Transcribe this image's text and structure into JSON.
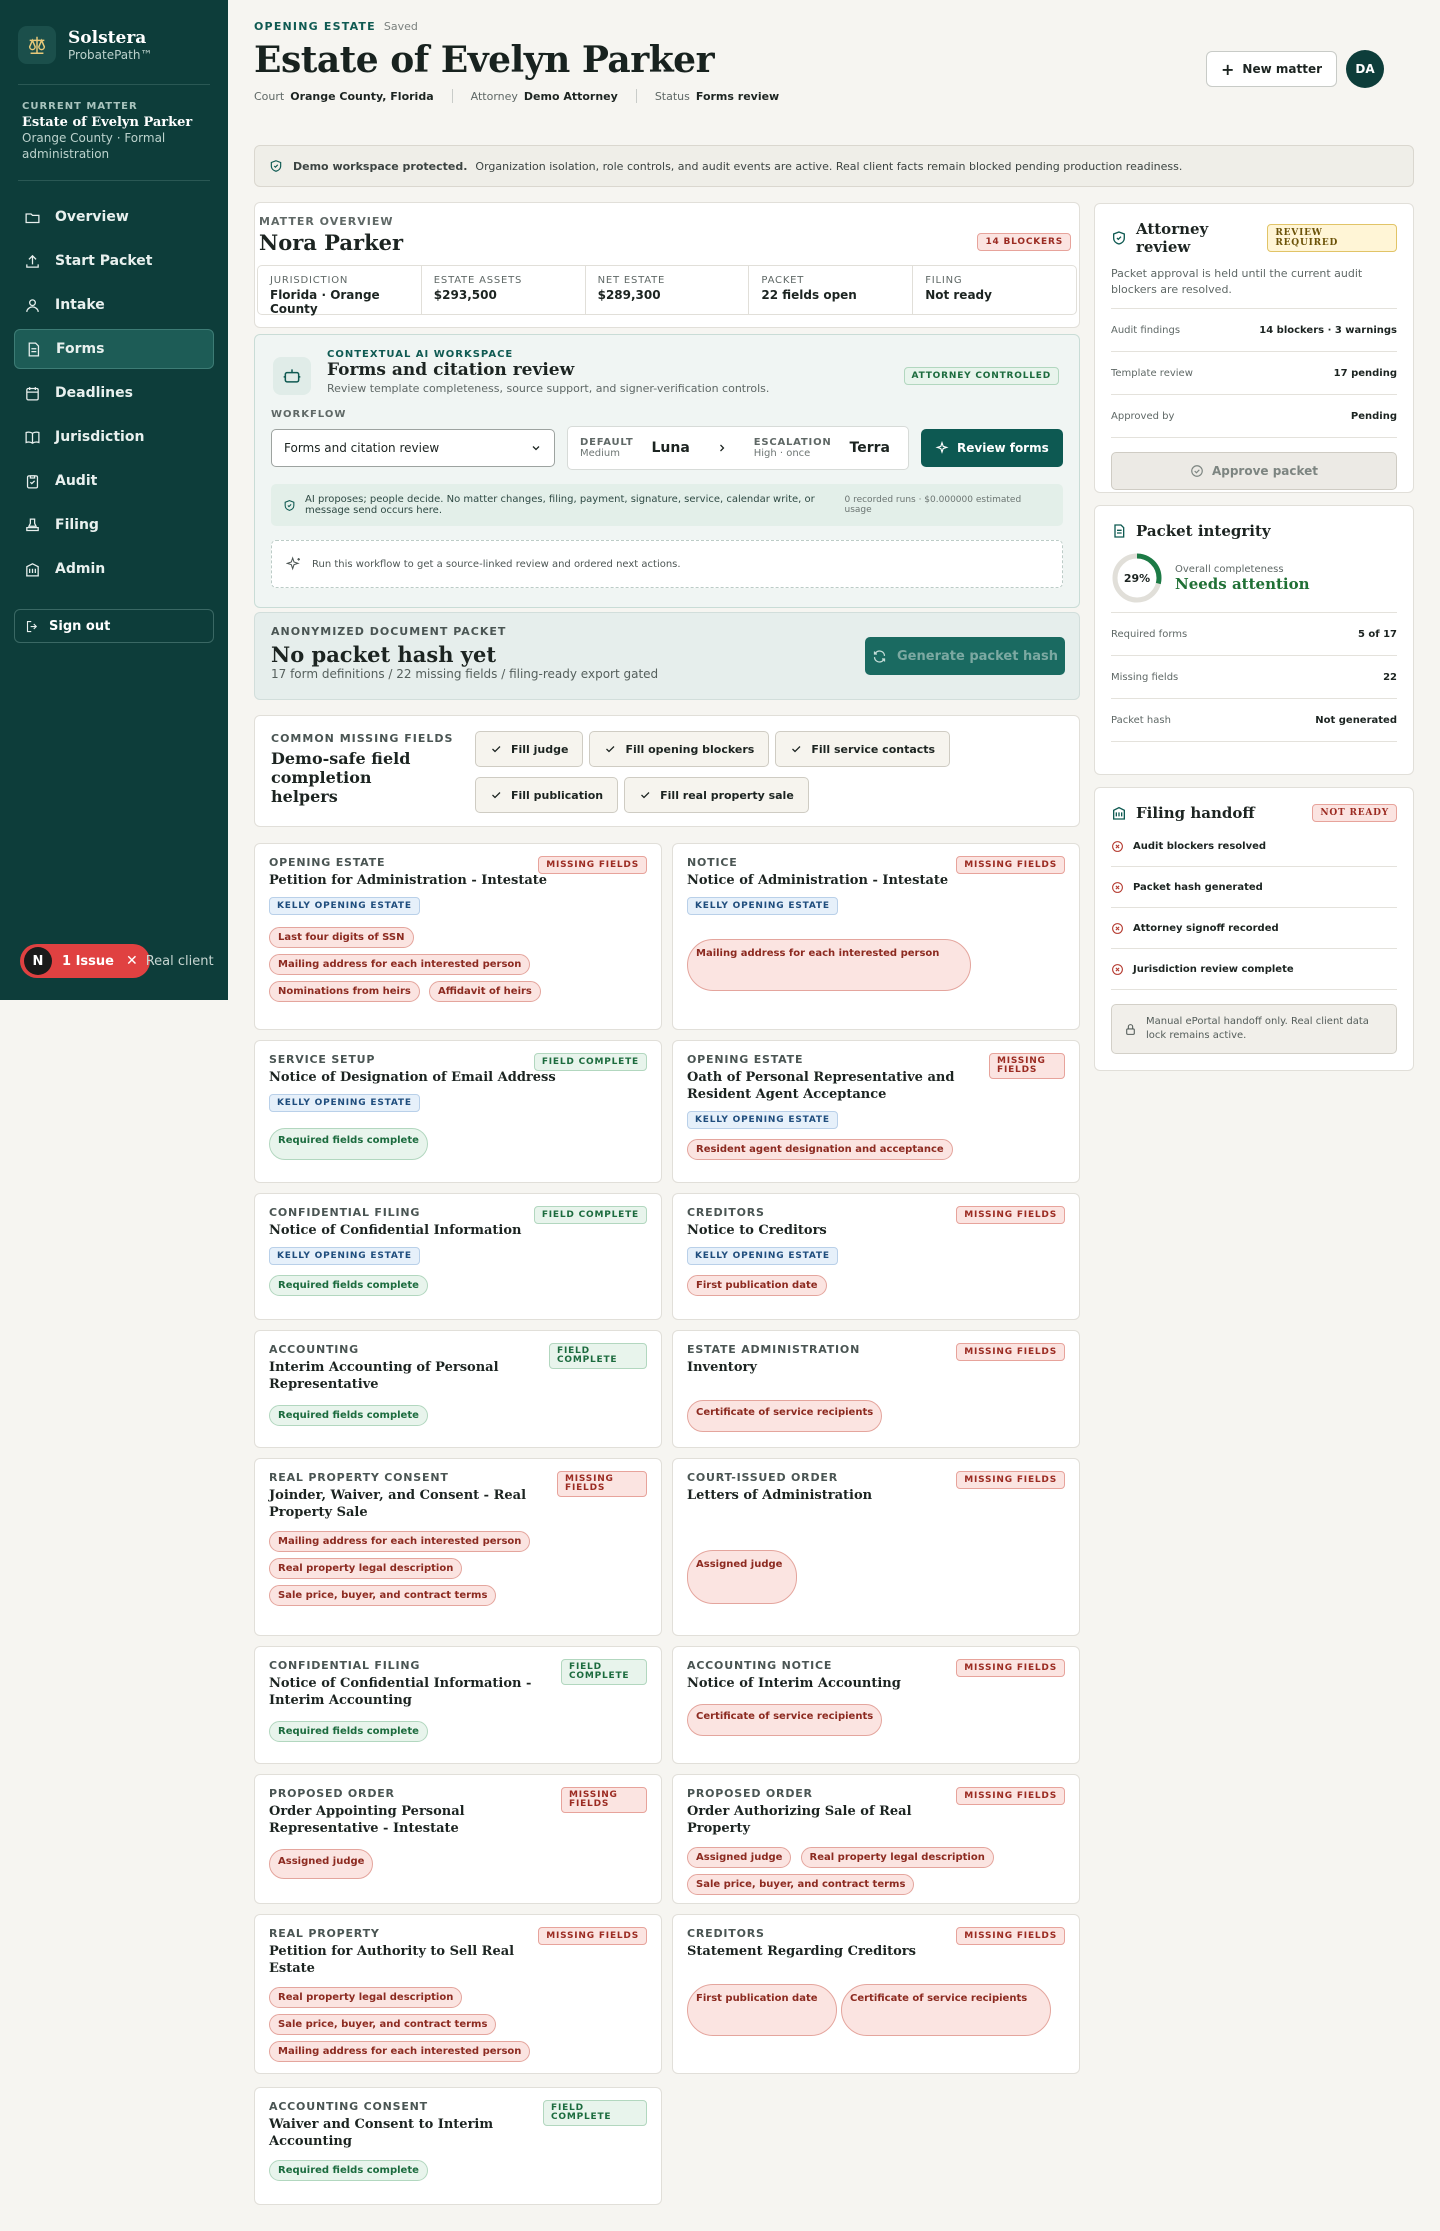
{
  "sidebar": {
    "brand_name": "Solstera",
    "brand_sub": "ProbatePath™",
    "current_matter_label": "CURRENT MATTER",
    "current_matter_name": "Estate of Evelyn Parker",
    "current_matter_sub": "Orange County · Formal administration",
    "nav": [
      {
        "label": "Overview",
        "icon": "home-icon"
      },
      {
        "label": "Start Packet",
        "icon": "upload-icon"
      },
      {
        "label": "Intake",
        "icon": "user-icon"
      },
      {
        "label": "Forms",
        "icon": "document-icon"
      },
      {
        "label": "Deadlines",
        "icon": "calendar-icon"
      },
      {
        "label": "Jurisdiction",
        "icon": "book-icon"
      },
      {
        "label": "Audit",
        "icon": "clipboard-check-icon"
      },
      {
        "label": "Filing",
        "icon": "stamp-icon"
      },
      {
        "label": "Admin",
        "icon": "building-icon"
      }
    ],
    "active_nav": "Forms",
    "signout": "Sign out",
    "issue_avatar": "N",
    "issue_label": "1 Issue",
    "issue_trailing": "Real client"
  },
  "header": {
    "eyebrow": "OPENING ESTATE",
    "saved": "Saved",
    "title": "Estate of Evelyn Parker",
    "court_label": "Court",
    "court_value": "Orange County, Florida",
    "attorney_label": "Attorney",
    "attorney_value": "Demo Attorney",
    "status_label": "Status",
    "status_value": "Forms review",
    "new_matter": "New matter",
    "avatar": "DA"
  },
  "banner": {
    "bold": "Demo workspace protected.",
    "text": "Organization isolation, role controls, and audit events are active. Real client facts remain blocked pending production readiness."
  },
  "overview": {
    "label": "MATTER OVERVIEW",
    "name": "Nora Parker",
    "blockers_badge": "14 BLOCKERS",
    "stats": [
      {
        "k": "JURISDICTION",
        "v": "Florida · Orange County"
      },
      {
        "k": "ESTATE ASSETS",
        "v": "$293,500"
      },
      {
        "k": "NET ESTATE",
        "v": "$289,300"
      },
      {
        "k": "PACKET",
        "v": "22 fields open"
      },
      {
        "k": "FILING",
        "v": "Not ready"
      }
    ]
  },
  "ai": {
    "eyebrow": "CONTEXTUAL AI WORKSPACE",
    "title": "Forms and citation review",
    "sub": "Review template completeness, source support, and signer-verification controls.",
    "badge": "ATTORNEY CONTROLLED",
    "workflow_label": "WORKFLOW",
    "workflow_value": "Forms and citation review",
    "default_label": "DEFAULT",
    "default_sub": "Medium",
    "default_value": "Luna",
    "escalation_label": "ESCALATION",
    "escalation_sub": "High · once",
    "escalation_value": "Terra",
    "review_button": "Review forms",
    "notice": "AI proposes; people decide. No matter changes, filing, payment, signature, service, calendar write, or message send occurs here.",
    "usage": "0 recorded runs · $0.000000 estimated usage",
    "run_hint": "Run this workflow to get a source-linked review and ordered next actions."
  },
  "packet": {
    "label": "ANONYMIZED DOCUMENT PACKET",
    "title": "No packet hash yet",
    "sub": "17 form definitions / 22 missing fields / filing-ready export gated",
    "button": "Generate packet hash"
  },
  "common": {
    "label": "COMMON MISSING FIELDS",
    "title": "Demo-safe field completion helpers",
    "chips": [
      "Fill judge",
      "Fill opening blockers",
      "Fill service contacts",
      "Fill publication",
      "Fill real property sale"
    ]
  },
  "forms": [
    {
      "cat": "OPENING ESTATE",
      "title": "Petition for Administration - Intestate",
      "status": "MISSING FIELDS",
      "ok": false,
      "tag": "KELLY OPENING ESTATE",
      "items": [
        "Last four digits of SSN",
        "Mailing address for each interested person",
        "Nominations from heirs",
        "Affidavit of heirs"
      ]
    },
    {
      "cat": "NOTICE",
      "title": "Notice of Administration - Intestate",
      "status": "MISSING FIELDS",
      "ok": false,
      "tag": "KELLY OPENING ESTATE",
      "items": [
        "Mailing address for each interested person"
      ]
    },
    {
      "cat": "SERVICE SETUP",
      "title": "Notice of Designation of Email Address",
      "status": "FIELD COMPLETE",
      "ok": true,
      "tag": "KELLY OPENING ESTATE",
      "items": [
        "Required fields complete"
      ]
    },
    {
      "cat": "OPENING ESTATE",
      "title": "Oath of Personal Representative and Resident Agent Acceptance",
      "status": "MISSING FIELDS",
      "ok": false,
      "tag": "KELLY OPENING ESTATE",
      "items": [
        "Resident agent designation and acceptance"
      ]
    },
    {
      "cat": "CONFIDENTIAL FILING",
      "title": "Notice of Confidential Information",
      "status": "FIELD COMPLETE",
      "ok": true,
      "tag": "KELLY OPENING ESTATE",
      "items": [
        "Required fields complete"
      ]
    },
    {
      "cat": "CREDITORS",
      "title": "Notice to Creditors",
      "status": "MISSING FIELDS",
      "ok": false,
      "tag": "KELLY OPENING ESTATE",
      "items": [
        "First publication date"
      ]
    },
    {
      "cat": "ACCOUNTING",
      "title": "Interim Accounting of Personal Representative",
      "status": "FIELD COMPLETE",
      "ok": true,
      "tag": "",
      "items": [
        "Required fields complete"
      ]
    },
    {
      "cat": "ESTATE ADMINISTRATION",
      "title": "Inventory",
      "status": "MISSING FIELDS",
      "ok": false,
      "tag": "",
      "items": [
        "Certificate of service recipients"
      ]
    },
    {
      "cat": "REAL PROPERTY CONSENT",
      "title": "Joinder, Waiver, and Consent - Real Property Sale",
      "status": "MISSING FIELDS",
      "ok": false,
      "tag": "",
      "items": [
        "Mailing address for each interested person",
        "Real property legal description",
        "Sale price, buyer, and contract terms"
      ]
    },
    {
      "cat": "COURT-ISSUED ORDER",
      "title": "Letters of Administration",
      "status": "MISSING FIELDS",
      "ok": false,
      "tag": "",
      "items": [
        "Assigned judge"
      ]
    },
    {
      "cat": "CONFIDENTIAL FILING",
      "title": "Notice of Confidential Information - Interim Accounting",
      "status": "FIELD COMPLETE",
      "ok": true,
      "tag": "",
      "items": [
        "Required fields complete"
      ]
    },
    {
      "cat": "ACCOUNTING NOTICE",
      "title": "Notice of Interim Accounting",
      "status": "MISSING FIELDS",
      "ok": false,
      "tag": "",
      "items": [
        "Certificate of service recipients"
      ]
    },
    {
      "cat": "PROPOSED ORDER",
      "title": "Order Appointing Personal Representative - Intestate",
      "status": "MISSING FIELDS",
      "ok": false,
      "tag": "",
      "items": [
        "Assigned judge"
      ]
    },
    {
      "cat": "PROPOSED ORDER",
      "title": "Order Authorizing Sale of Real Property",
      "status": "MISSING FIELDS",
      "ok": false,
      "tag": "",
      "items": [
        "Assigned judge",
        "Real property legal description",
        "Sale price, buyer, and contract terms"
      ]
    },
    {
      "cat": "REAL PROPERTY",
      "title": "Petition for Authority to Sell Real Estate",
      "status": "MISSING FIELDS",
      "ok": false,
      "tag": "",
      "items": [
        "Real property legal description",
        "Sale price, buyer, and contract terms",
        "Mailing address for each interested person"
      ]
    },
    {
      "cat": "CREDITORS",
      "title": "Statement Regarding Creditors",
      "status": "MISSING FIELDS",
      "ok": false,
      "tag": "",
      "items": [
        "First publication date",
        "Certificate of service recipients"
      ]
    },
    {
      "cat": "ACCOUNTING CONSENT",
      "title": "Waiver and Consent to Interim Accounting",
      "status": "FIELD COMPLETE",
      "ok": true,
      "tag": "",
      "items": [
        "Required fields complete"
      ]
    }
  ],
  "review": {
    "title": "Attorney review",
    "badge": "REVIEW REQUIRED",
    "desc": "Packet approval is held until the current audit blockers are resolved.",
    "rows": [
      {
        "k": "Audit findings",
        "v": "14 blockers · 3 warnings"
      },
      {
        "k": "Template review",
        "v": "17 pending"
      },
      {
        "k": "Approved by",
        "v": "Pending"
      }
    ],
    "button": "Approve packet"
  },
  "integrity": {
    "title": "Packet integrity",
    "percent_label": "29%",
    "percent": 29,
    "overall_label": "Overall completeness",
    "overall_value": "Needs attention",
    "rows": [
      {
        "k": "Required forms",
        "v": "5 of 17"
      },
      {
        "k": "Missing fields",
        "v": "22"
      },
      {
        "k": "Packet hash",
        "v": "Not generated"
      }
    ]
  },
  "handoff": {
    "title": "Filing handoff",
    "badge": "NOT READY",
    "checks": [
      "Audit blockers resolved",
      "Packet hash generated",
      "Attorney signoff recorded",
      "Jurisdiction review complete"
    ],
    "note": "Manual ePortal handoff only. Real client data lock remains active."
  },
  "colors": {
    "sidebar": "#0d3d3a",
    "accent": "#0d5952",
    "danger": "#e04141"
  }
}
